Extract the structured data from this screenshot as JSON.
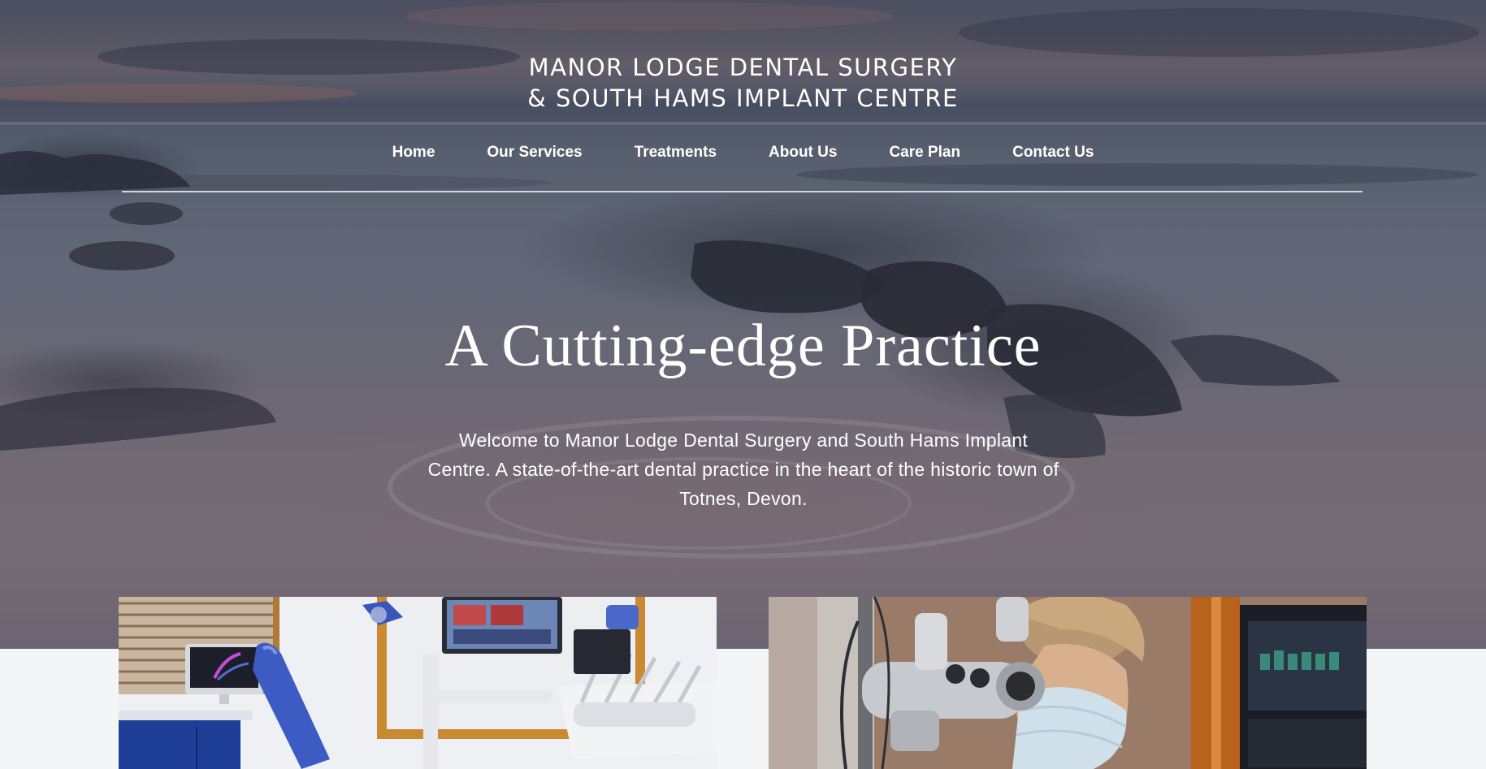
{
  "header": {
    "logo_line1": "MANOR LODGE DENTAL SURGERY",
    "logo_line2": "& SOUTH HAMS IMPLANT CENTRE"
  },
  "nav": {
    "items": [
      {
        "label": "Home"
      },
      {
        "label": "Our Services"
      },
      {
        "label": "Treatments"
      },
      {
        "label": "About Us"
      },
      {
        "label": "Care Plan"
      },
      {
        "label": "Contact Us"
      }
    ]
  },
  "hero": {
    "title": "A Cutting-edge Practice",
    "text": "Welcome to Manor Lodge Dental Surgery and South Hams Implant Centre. A state-of-the-art dental practice in the heart of the historic town of Totnes, Devon."
  },
  "colors": {
    "accent_blue": "#2f4fa8",
    "hero_overlay": "#141826"
  }
}
